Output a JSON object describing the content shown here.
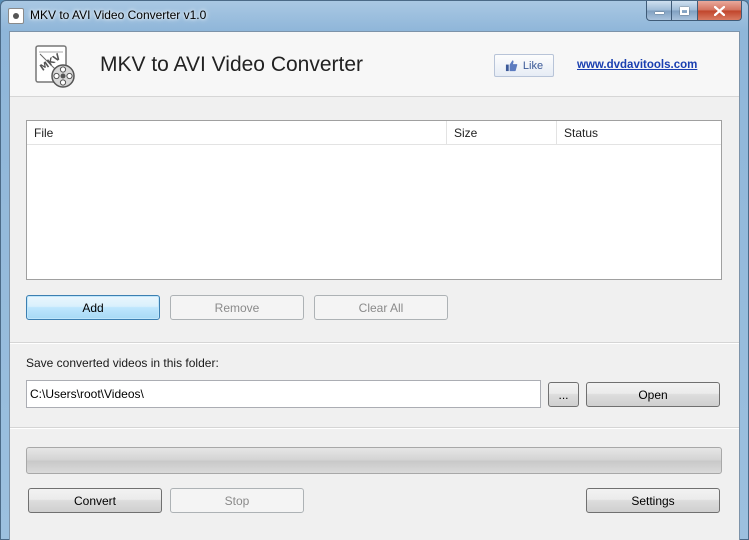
{
  "window": {
    "title": "MKV to AVI Video Converter v1.0"
  },
  "header": {
    "app_title": "MKV to AVI Video Converter",
    "like_label": "Like",
    "site_link": "www.dvdavitools.com"
  },
  "filelist": {
    "columns": [
      "File",
      "Size",
      "Status"
    ],
    "rows": []
  },
  "buttons": {
    "add": "Add",
    "remove": "Remove",
    "clear_all": "Clear All",
    "browse": "...",
    "open": "Open",
    "convert": "Convert",
    "stop": "Stop",
    "settings": "Settings"
  },
  "folder": {
    "label": "Save converted videos in this folder:",
    "path": "C:\\Users\\root\\Videos\\"
  },
  "progress": {
    "value": 0
  },
  "colors": {
    "link": "#1a3fb0",
    "like_text": "#3b5998",
    "focus_border": "#3c7fb1"
  }
}
